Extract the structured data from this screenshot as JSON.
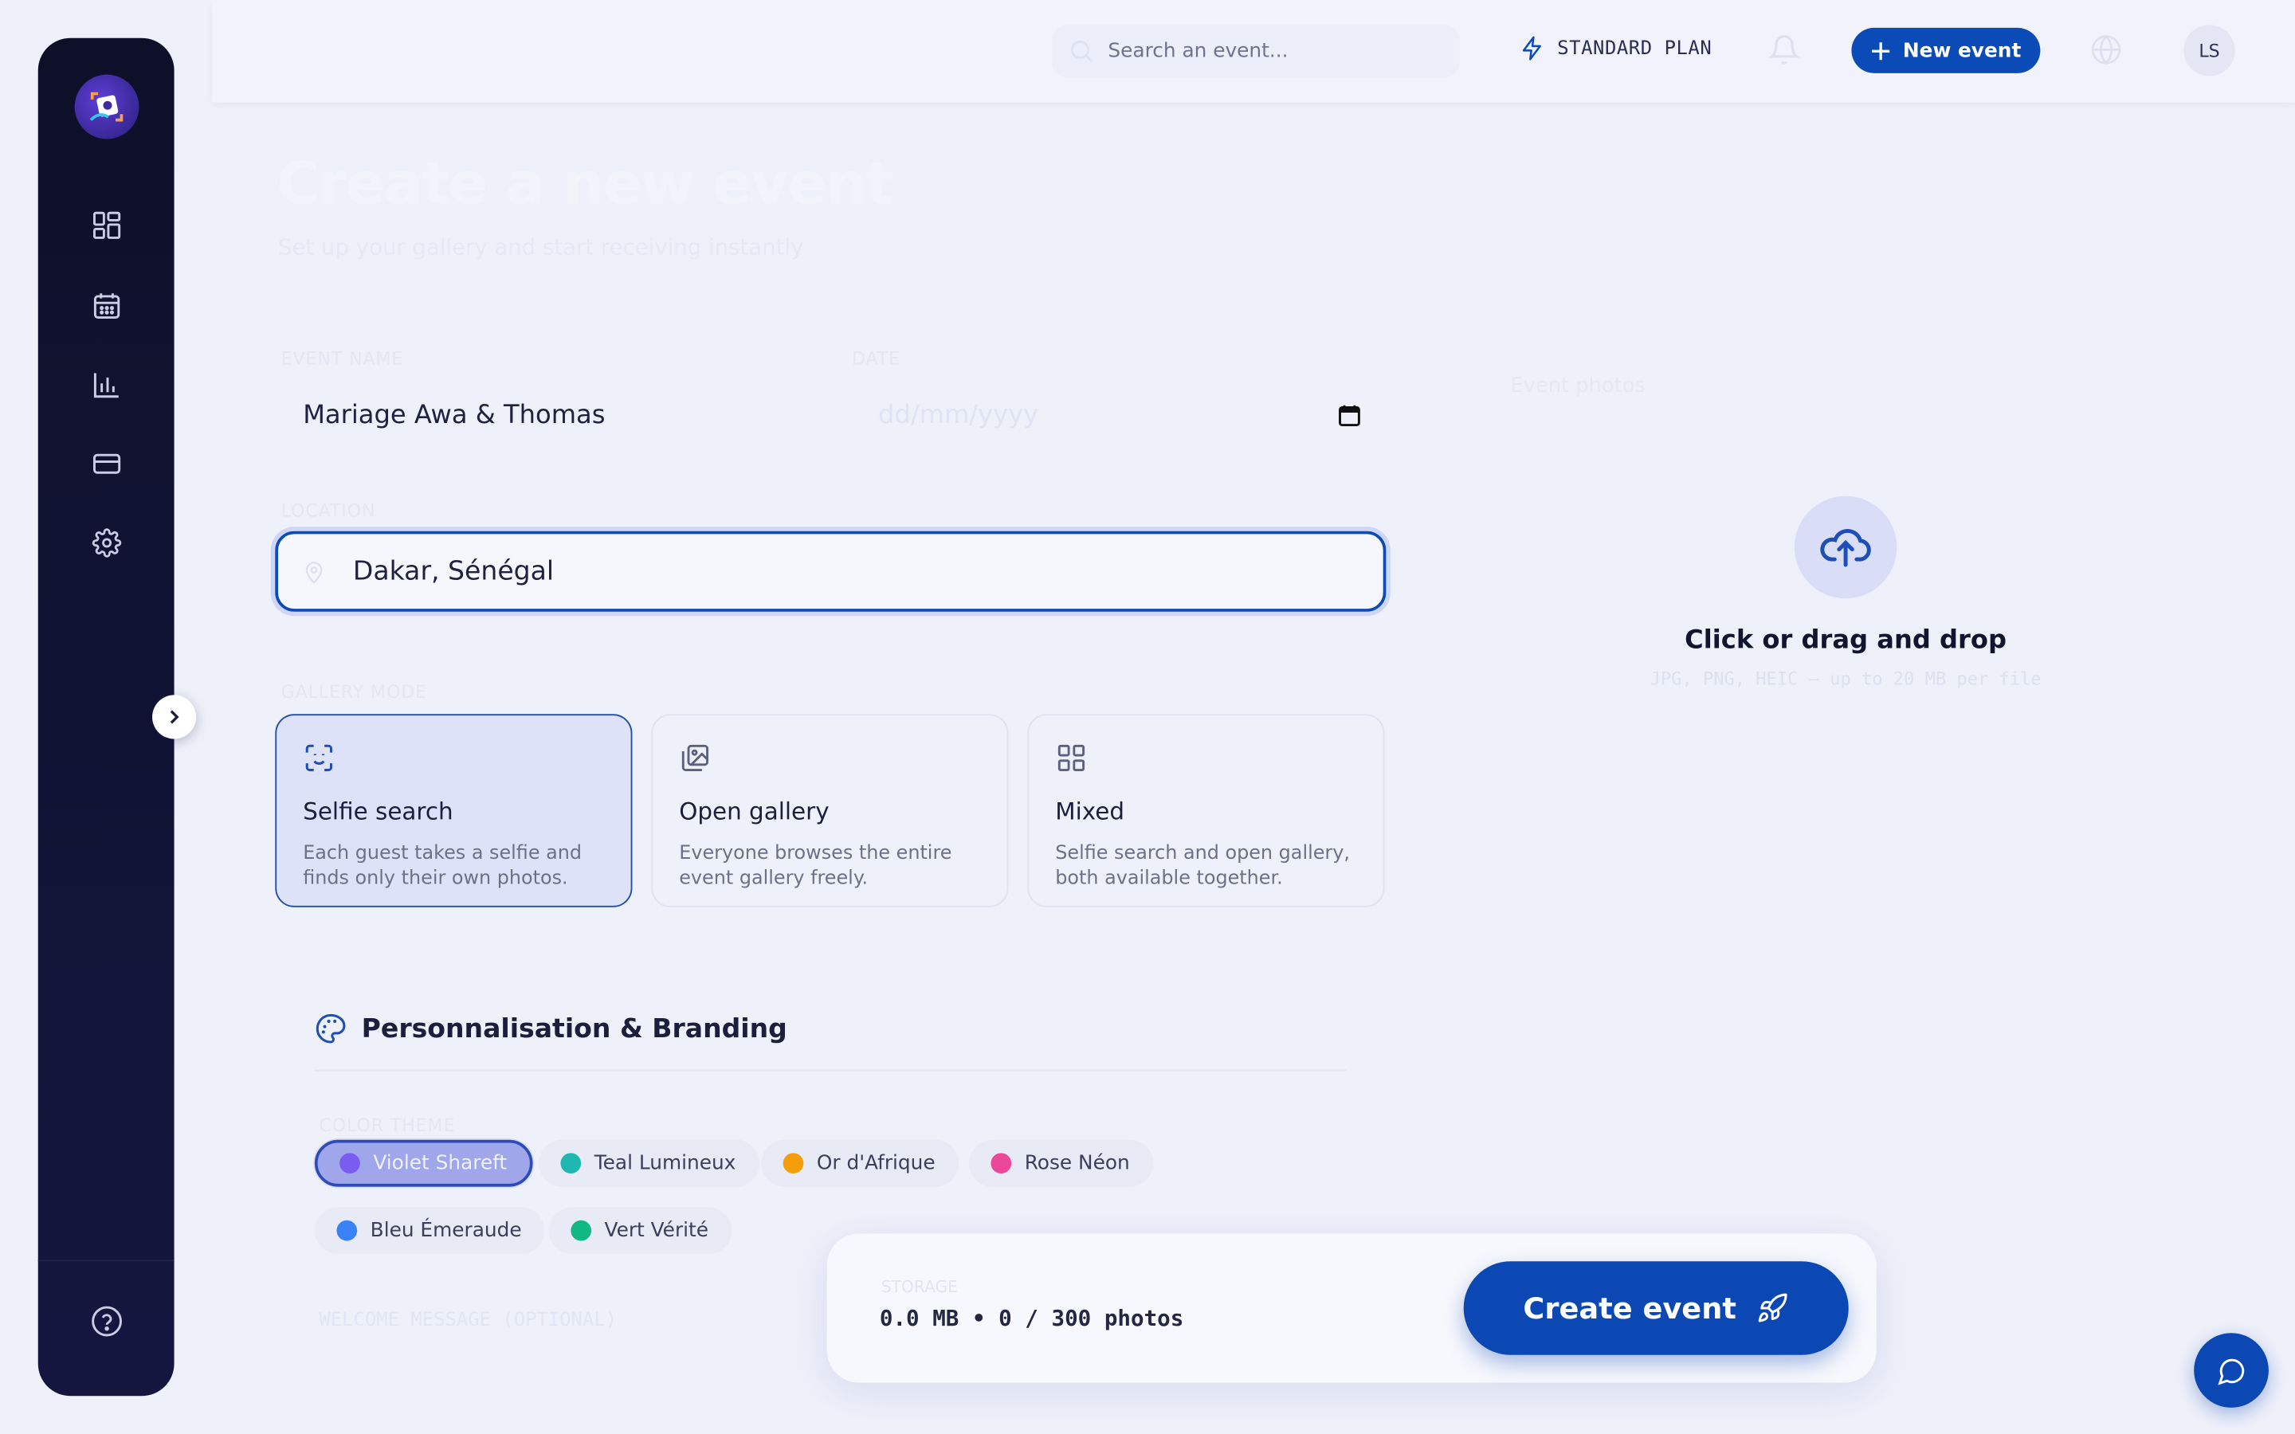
{
  "header": {
    "search_placeholder": "Search an event...",
    "plan_label": "STANDARD PLAN",
    "new_event_label": "New event",
    "avatar_initials": "LS"
  },
  "page": {
    "title": "Create a new event",
    "subtitle": "Set up your gallery and start receiving instantly"
  },
  "form": {
    "event_name_label": "EVENT NAME",
    "event_name_value": "Mariage Awa & Thomas",
    "date_label": "DATE",
    "date_placeholder": "dd/mm/yyyy",
    "location_label": "LOCATION",
    "location_value": "Dakar, Sénégal",
    "mode_label": "GALLERY MODE"
  },
  "modes": [
    {
      "title": "Selfie search",
      "desc": "Each guest takes a selfie and finds only their own photos.",
      "selected": true
    },
    {
      "title": "Open gallery",
      "desc": "Everyone browses the entire event gallery freely.",
      "selected": false
    },
    {
      "title": "Mixed",
      "desc": "Selfie search and open gallery, both available together.",
      "selected": false
    }
  ],
  "branding": {
    "title": "Personnalisation & Branding",
    "theme_label": "COLOR THEME",
    "swatches": [
      {
        "label": "Violet Shareft",
        "color": "#7b5cf0",
        "active": true
      },
      {
        "label": "Teal Lumineux",
        "color": "#1fb7b0",
        "active": false
      },
      {
        "label": "Or d'Afrique",
        "color": "#f59e0b",
        "active": false
      },
      {
        "label": "Rose Néon",
        "color": "#ec4899",
        "active": false
      },
      {
        "label": "Bleu Émeraude",
        "color": "#3b82f6",
        "active": false
      },
      {
        "label": "Vert Vérité",
        "color": "#10b981",
        "active": false
      }
    ],
    "faint_line": "WELCOME MESSAGE (OPTIONAL)"
  },
  "upload": {
    "title": "Event photos",
    "cta": "Click or drag and drop",
    "hint": "JPG, PNG, HEIC — up to 20 MB per file"
  },
  "footer_bar": {
    "label": "STORAGE",
    "stats": "0.0 MB • 0 / 300 photos",
    "create_label": "Create event"
  },
  "colors": {
    "accent": "#0b4bb7",
    "sidebar": "#0e1029"
  }
}
